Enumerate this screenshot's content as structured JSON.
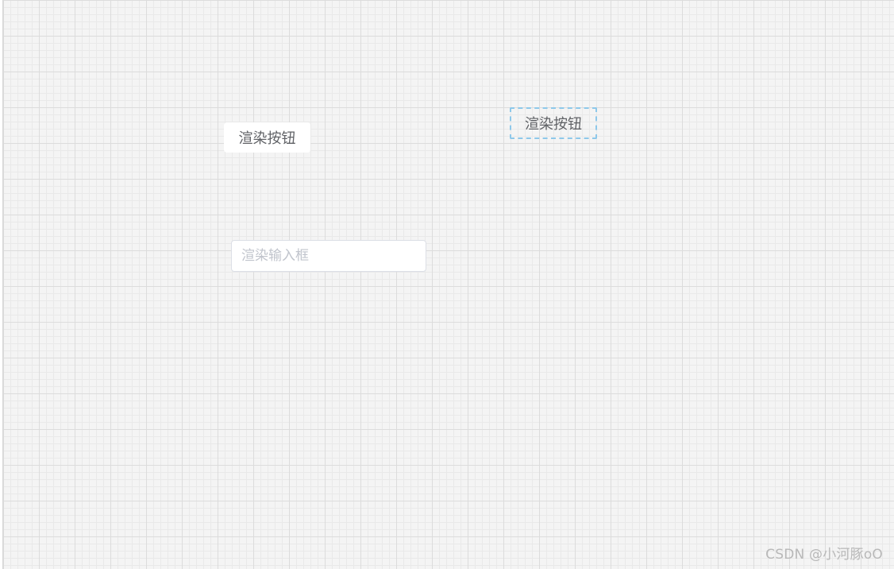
{
  "canvas": {
    "components": [
      {
        "type": "button",
        "label": "渲染按钮",
        "selected": false
      },
      {
        "type": "button",
        "label": "渲染按钮",
        "selected": true
      },
      {
        "type": "input",
        "value": "",
        "placeholder": "渲染输入框"
      }
    ]
  },
  "watermark": {
    "text": "CSDN @小河豚oO"
  },
  "colors": {
    "grid_major": "#dcdcdc",
    "grid_minor": "#e9e9e9",
    "canvas_bg": "#f4f4f4",
    "selection_border": "#8ec8ea",
    "button_text": "#606266",
    "placeholder_text": "#c0c4cc"
  }
}
